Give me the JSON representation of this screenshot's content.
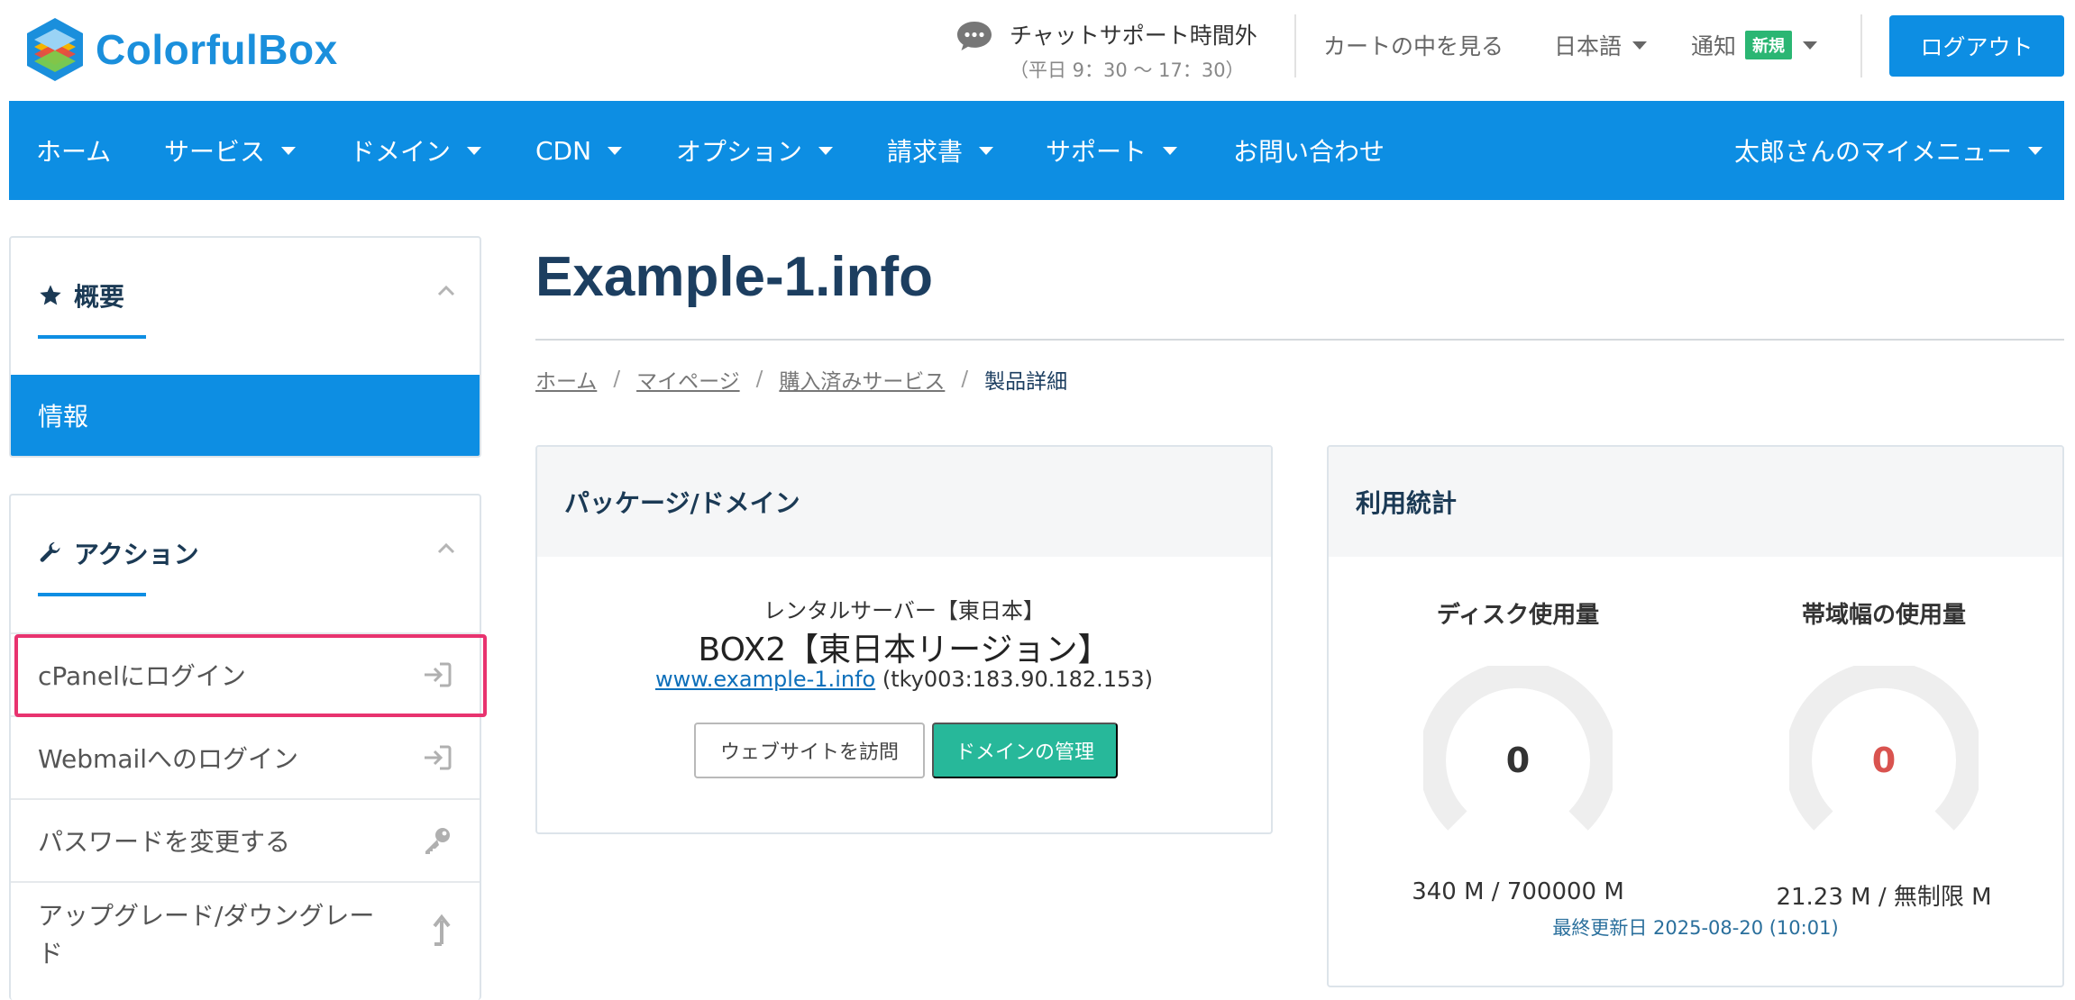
{
  "header": {
    "logo_text": "ColorfulBox",
    "chat_title": "チャットサポート時間外",
    "chat_hours": "（平日 9：30 〜 17：30）",
    "cart_link": "カートの中を見る",
    "language": "日本語",
    "notify_label": "通知",
    "notify_badge": "新規",
    "logout": "ログアウト"
  },
  "nav": {
    "items": [
      "ホーム",
      "サービス",
      "ドメイン",
      "CDN",
      "オプション",
      "請求書",
      "サポート",
      "お問い合わせ"
    ],
    "my_menu": "太郎さんのマイメニュー"
  },
  "sidebar": {
    "overview": {
      "title": "概要",
      "active_item": "情報"
    },
    "actions": {
      "title": "アクション",
      "items": [
        "cPanelにログイン",
        "Webmailへのログイン",
        "パスワードを変更する",
        "アップグレード/ダウングレード"
      ]
    }
  },
  "main": {
    "title": "Example-1.info",
    "breadcrumb": [
      "ホーム",
      "マイページ",
      "購入済みサービス",
      "製品詳細"
    ],
    "package": {
      "heading": "パッケージ/ドメイン",
      "group": "レンタルサーバー【東日本】",
      "name": "BOX2【東日本リージョン】",
      "domain": "www.example-1.info",
      "server": "(tky003:183.90.182.153)",
      "visit_button": "ウェブサイトを訪問",
      "manage_button": "ドメインの管理"
    },
    "stats": {
      "heading": "利用統計",
      "disk_title": "ディスク使用量",
      "disk_value": "0",
      "disk_amount": "340 M / 700000 M",
      "bandwidth_title": "帯域幅の使用量",
      "bandwidth_value": "0",
      "bandwidth_amount": "21.23 M / 無制限 M",
      "updated": "最終更新日 2025-08-20 (10:01)"
    }
  },
  "colors": {
    "brand_blue": "#0d8ee3",
    "badge_green": "#2bb673",
    "button_teal": "#27b89a",
    "highlight_pink": "#e8336f",
    "bandwidth_value_red": "#d9534f"
  }
}
